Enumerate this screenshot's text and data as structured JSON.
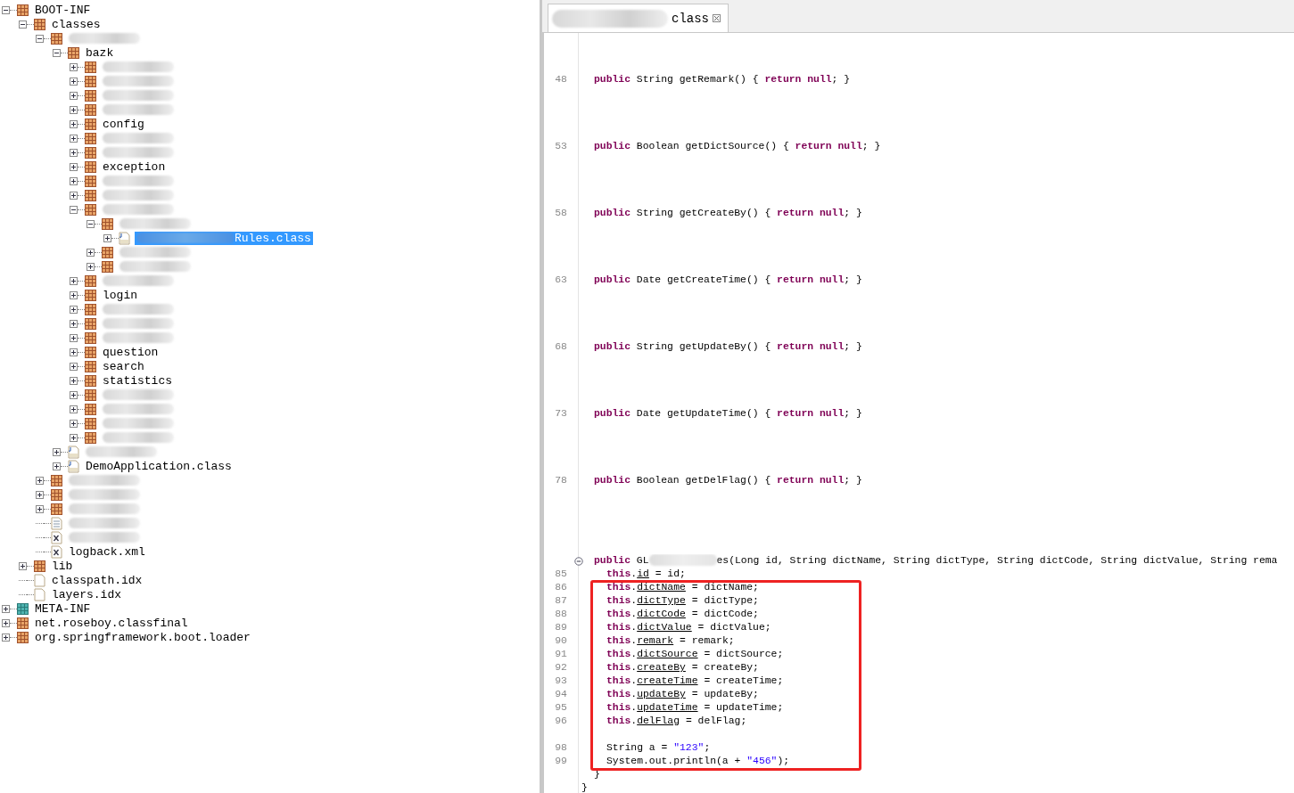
{
  "tree": [
    {
      "label": "BOOT-INF",
      "kind": "package",
      "expanded": true,
      "children": [
        {
          "label": "classes",
          "kind": "package",
          "expanded": true,
          "children": [
            {
              "redacted": true,
              "kind": "package",
              "expanded": true,
              "children": [
                {
                  "label": "bazk",
                  "kind": "package",
                  "expanded": true,
                  "children": [
                    {
                      "redacted": true,
                      "kind": "package",
                      "expanded": false
                    },
                    {
                      "redacted": true,
                      "kind": "package",
                      "expanded": false
                    },
                    {
                      "redacted": true,
                      "kind": "package",
                      "expanded": false
                    },
                    {
                      "redacted": true,
                      "kind": "package",
                      "expanded": false
                    },
                    {
                      "label": "config",
                      "kind": "package",
                      "expanded": false
                    },
                    {
                      "redacted": true,
                      "kind": "package",
                      "expanded": false
                    },
                    {
                      "redacted": true,
                      "kind": "package",
                      "expanded": false
                    },
                    {
                      "label": "exception",
                      "kind": "package",
                      "expanded": false
                    },
                    {
                      "redacted": true,
                      "kind": "package",
                      "expanded": false
                    },
                    {
                      "redacted": true,
                      "kind": "package",
                      "expanded": false
                    },
                    {
                      "redacted": true,
                      "kind": "package",
                      "expanded": true,
                      "children": [
                        {
                          "redacted": true,
                          "kind": "package",
                          "expanded": true,
                          "children": [
                            {
                              "label": "Rules.class",
                              "redacted": true,
                              "kind": "class",
                              "expanded": false,
                              "selected": true
                            }
                          ]
                        },
                        {
                          "redacted": true,
                          "kind": "package",
                          "expanded": false
                        },
                        {
                          "redacted": true,
                          "kind": "package",
                          "expanded": false
                        }
                      ]
                    },
                    {
                      "redacted": true,
                      "kind": "package",
                      "expanded": false
                    },
                    {
                      "label": "login",
                      "kind": "package",
                      "expanded": false
                    },
                    {
                      "redacted": true,
                      "kind": "package",
                      "expanded": false
                    },
                    {
                      "redacted": true,
                      "kind": "package",
                      "expanded": false
                    },
                    {
                      "redacted": true,
                      "kind": "package",
                      "expanded": false
                    },
                    {
                      "label": "question",
                      "kind": "package",
                      "expanded": false
                    },
                    {
                      "label": "search",
                      "kind": "package",
                      "expanded": false
                    },
                    {
                      "label": "statistics",
                      "kind": "package",
                      "expanded": false
                    },
                    {
                      "redacted": true,
                      "kind": "package",
                      "expanded": false
                    },
                    {
                      "redacted": true,
                      "kind": "package",
                      "expanded": false
                    },
                    {
                      "redacted": true,
                      "kind": "package",
                      "expanded": false
                    },
                    {
                      "redacted": true,
                      "kind": "package",
                      "expanded": false
                    }
                  ]
                },
                {
                  "redacted": true,
                  "kind": "class",
                  "expanded": false
                },
                {
                  "label": "DemoApplication.class",
                  "kind": "class",
                  "expanded": false
                }
              ]
            },
            {
              "redacted": true,
              "kind": "package",
              "expanded": false
            },
            {
              "redacted": true,
              "kind": "package",
              "expanded": false
            },
            {
              "redacted": true,
              "kind": "package",
              "expanded": false
            },
            {
              "redacted": true,
              "kind": "properties"
            },
            {
              "redacted": true,
              "kind": "xml"
            },
            {
              "label": "logback.xml",
              "kind": "xml"
            }
          ]
        },
        {
          "label": "lib",
          "kind": "package",
          "expanded": false
        },
        {
          "label": "classpath.idx",
          "kind": "file"
        },
        {
          "label": "layers.idx",
          "kind": "file"
        }
      ]
    },
    {
      "label": "META-INF",
      "kind": "meta",
      "expanded": false
    },
    {
      "label": "net.roseboy.classfinal",
      "kind": "package",
      "expanded": false
    },
    {
      "label": "org.springframework.boot.loader",
      "kind": "package",
      "expanded": false
    }
  ],
  "tab": {
    "label": "class",
    "redacted_prefix": true
  },
  "code": [
    {
      "number": "48",
      "kind": "member",
      "tokens": [
        {
          "kind": "kw",
          "text": "public"
        },
        {
          "kind": "plain",
          "text": " String getRemark() { "
        },
        {
          "kind": "kw",
          "text": "return null"
        },
        {
          "kind": "plain",
          "text": "; }"
        }
      ]
    },
    {
      "number": "53",
      "kind": "member",
      "tokens": [
        {
          "kind": "kw",
          "text": "public"
        },
        {
          "kind": "plain",
          "text": " Boolean getDictSource() { "
        },
        {
          "kind": "kw",
          "text": "return null"
        },
        {
          "kind": "plain",
          "text": "; }"
        }
      ]
    },
    {
      "number": "58",
      "kind": "member",
      "tokens": [
        {
          "kind": "kw",
          "text": "public"
        },
        {
          "kind": "plain",
          "text": " String getCreateBy() { "
        },
        {
          "kind": "kw",
          "text": "return null"
        },
        {
          "kind": "plain",
          "text": "; }"
        }
      ]
    },
    {
      "number": "63",
      "kind": "member",
      "tokens": [
        {
          "kind": "kw",
          "text": "public"
        },
        {
          "kind": "plain",
          "text": " Date getCreateTime() { "
        },
        {
          "kind": "kw",
          "text": "return null"
        },
        {
          "kind": "plain",
          "text": "; }"
        }
      ]
    },
    {
      "number": "68",
      "kind": "member",
      "tokens": [
        {
          "kind": "kw",
          "text": "public"
        },
        {
          "kind": "plain",
          "text": " String getUpdateBy() { "
        },
        {
          "kind": "kw",
          "text": "return null"
        },
        {
          "kind": "plain",
          "text": "; }"
        }
      ]
    },
    {
      "number": "73",
      "kind": "member",
      "tokens": [
        {
          "kind": "kw",
          "text": "public"
        },
        {
          "kind": "plain",
          "text": " Date getUpdateTime() { "
        },
        {
          "kind": "kw",
          "text": "return null"
        },
        {
          "kind": "plain",
          "text": "; }"
        }
      ]
    },
    {
      "number": "78",
      "kind": "member",
      "tokens": [
        {
          "kind": "kw",
          "text": "public"
        },
        {
          "kind": "plain",
          "text": " Boolean getDelFlag() { "
        },
        {
          "kind": "kw",
          "text": "return null"
        },
        {
          "kind": "plain",
          "text": "; }"
        }
      ]
    },
    {
      "kind": "member",
      "fold": true,
      "tokens": [
        {
          "kind": "kw",
          "text": "public"
        },
        {
          "kind": "plain",
          "text": " GL"
        },
        {
          "kind": "redacted"
        },
        {
          "kind": "plain",
          "text": "es(Long id, String dictName, String dictType, String dictCode, String dictValue, String rema"
        }
      ]
    },
    {
      "number": "85",
      "kind": "statement",
      "tokens": [
        {
          "kind": "kw",
          "text": "this"
        },
        {
          "kind": "plain",
          "text": "."
        },
        {
          "kind": "field",
          "text": "id"
        },
        {
          "kind": "plain",
          "text": " = id;"
        }
      ]
    },
    {
      "kind": "highlight",
      "children": [
        {
          "number": "86",
          "kind": "statement",
          "tokens": [
            {
              "kind": "kw",
              "text": "this"
            },
            {
              "kind": "plain",
              "text": "."
            },
            {
              "kind": "field",
              "text": "dictName"
            },
            {
              "kind": "plain",
              "text": " = dictName;"
            }
          ]
        },
        {
          "number": "87",
          "kind": "statement",
          "tokens": [
            {
              "kind": "kw",
              "text": "this"
            },
            {
              "kind": "plain",
              "text": "."
            },
            {
              "kind": "field",
              "text": "dictType"
            },
            {
              "kind": "plain",
              "text": " = dictType;"
            }
          ]
        },
        {
          "number": "88",
          "kind": "statement",
          "tokens": [
            {
              "kind": "kw",
              "text": "this"
            },
            {
              "kind": "plain",
              "text": "."
            },
            {
              "kind": "field",
              "text": "dictCode"
            },
            {
              "kind": "plain",
              "text": " = dictCode;"
            }
          ]
        },
        {
          "number": "89",
          "kind": "statement",
          "tokens": [
            {
              "kind": "kw",
              "text": "this"
            },
            {
              "kind": "plain",
              "text": "."
            },
            {
              "kind": "field",
              "text": "dictValue"
            },
            {
              "kind": "plain",
              "text": " = dictValue;"
            }
          ]
        },
        {
          "number": "90",
          "kind": "statement",
          "tokens": [
            {
              "kind": "kw",
              "text": "this"
            },
            {
              "kind": "plain",
              "text": "."
            },
            {
              "kind": "field",
              "text": "remark"
            },
            {
              "kind": "plain",
              "text": " = remark;"
            }
          ]
        },
        {
          "number": "91",
          "kind": "statement",
          "tokens": [
            {
              "kind": "kw",
              "text": "this"
            },
            {
              "kind": "plain",
              "text": "."
            },
            {
              "kind": "field",
              "text": "dictSource"
            },
            {
              "kind": "plain",
              "text": " = dictSource;"
            }
          ]
        },
        {
          "number": "92",
          "kind": "statement",
          "tokens": [
            {
              "kind": "kw",
              "text": "this"
            },
            {
              "kind": "plain",
              "text": "."
            },
            {
              "kind": "field",
              "text": "createBy"
            },
            {
              "kind": "plain",
              "text": " = createBy;"
            }
          ]
        },
        {
          "number": "93",
          "kind": "statement",
          "tokens": [
            {
              "kind": "kw",
              "text": "this"
            },
            {
              "kind": "plain",
              "text": "."
            },
            {
              "kind": "field",
              "text": "createTime"
            },
            {
              "kind": "plain",
              "text": " = createTime;"
            }
          ]
        },
        {
          "number": "94",
          "kind": "statement",
          "tokens": [
            {
              "kind": "kw",
              "text": "this"
            },
            {
              "kind": "plain",
              "text": "."
            },
            {
              "kind": "field",
              "text": "updateBy"
            },
            {
              "kind": "plain",
              "text": " = updateBy;"
            }
          ]
        },
        {
          "number": "95",
          "kind": "statement",
          "tokens": [
            {
              "kind": "kw",
              "text": "this"
            },
            {
              "kind": "plain",
              "text": "."
            },
            {
              "kind": "field",
              "text": "updateTime"
            },
            {
              "kind": "plain",
              "text": " = updateTime;"
            }
          ]
        },
        {
          "number": "96",
          "kind": "statement",
          "tokens": [
            {
              "kind": "kw",
              "text": "this"
            },
            {
              "kind": "plain",
              "text": "."
            },
            {
              "kind": "field",
              "text": "delFlag"
            },
            {
              "kind": "plain",
              "text": " = delFlag;"
            }
          ]
        },
        {
          "number": "98",
          "kind": "statement",
          "tokens": [
            {
              "kind": "plain",
              "text": "String a = "
            },
            {
              "kind": "str",
              "text": "\"123\""
            },
            {
              "kind": "plain",
              "text": ";"
            }
          ]
        },
        {
          "number": "99",
          "kind": "statement",
          "tokens": [
            {
              "kind": "plain",
              "text": "System.out.println(a + "
            },
            {
              "kind": "str",
              "text": "\"456\""
            },
            {
              "kind": "plain",
              "text": ");"
            }
          ]
        }
      ]
    },
    {
      "kind": "member",
      "tokens": [
        {
          "kind": "plain",
          "text": "}"
        }
      ]
    },
    {
      "kind": "class_end",
      "tokens": [
        {
          "kind": "plain",
          "text": "}"
        }
      ]
    }
  ]
}
